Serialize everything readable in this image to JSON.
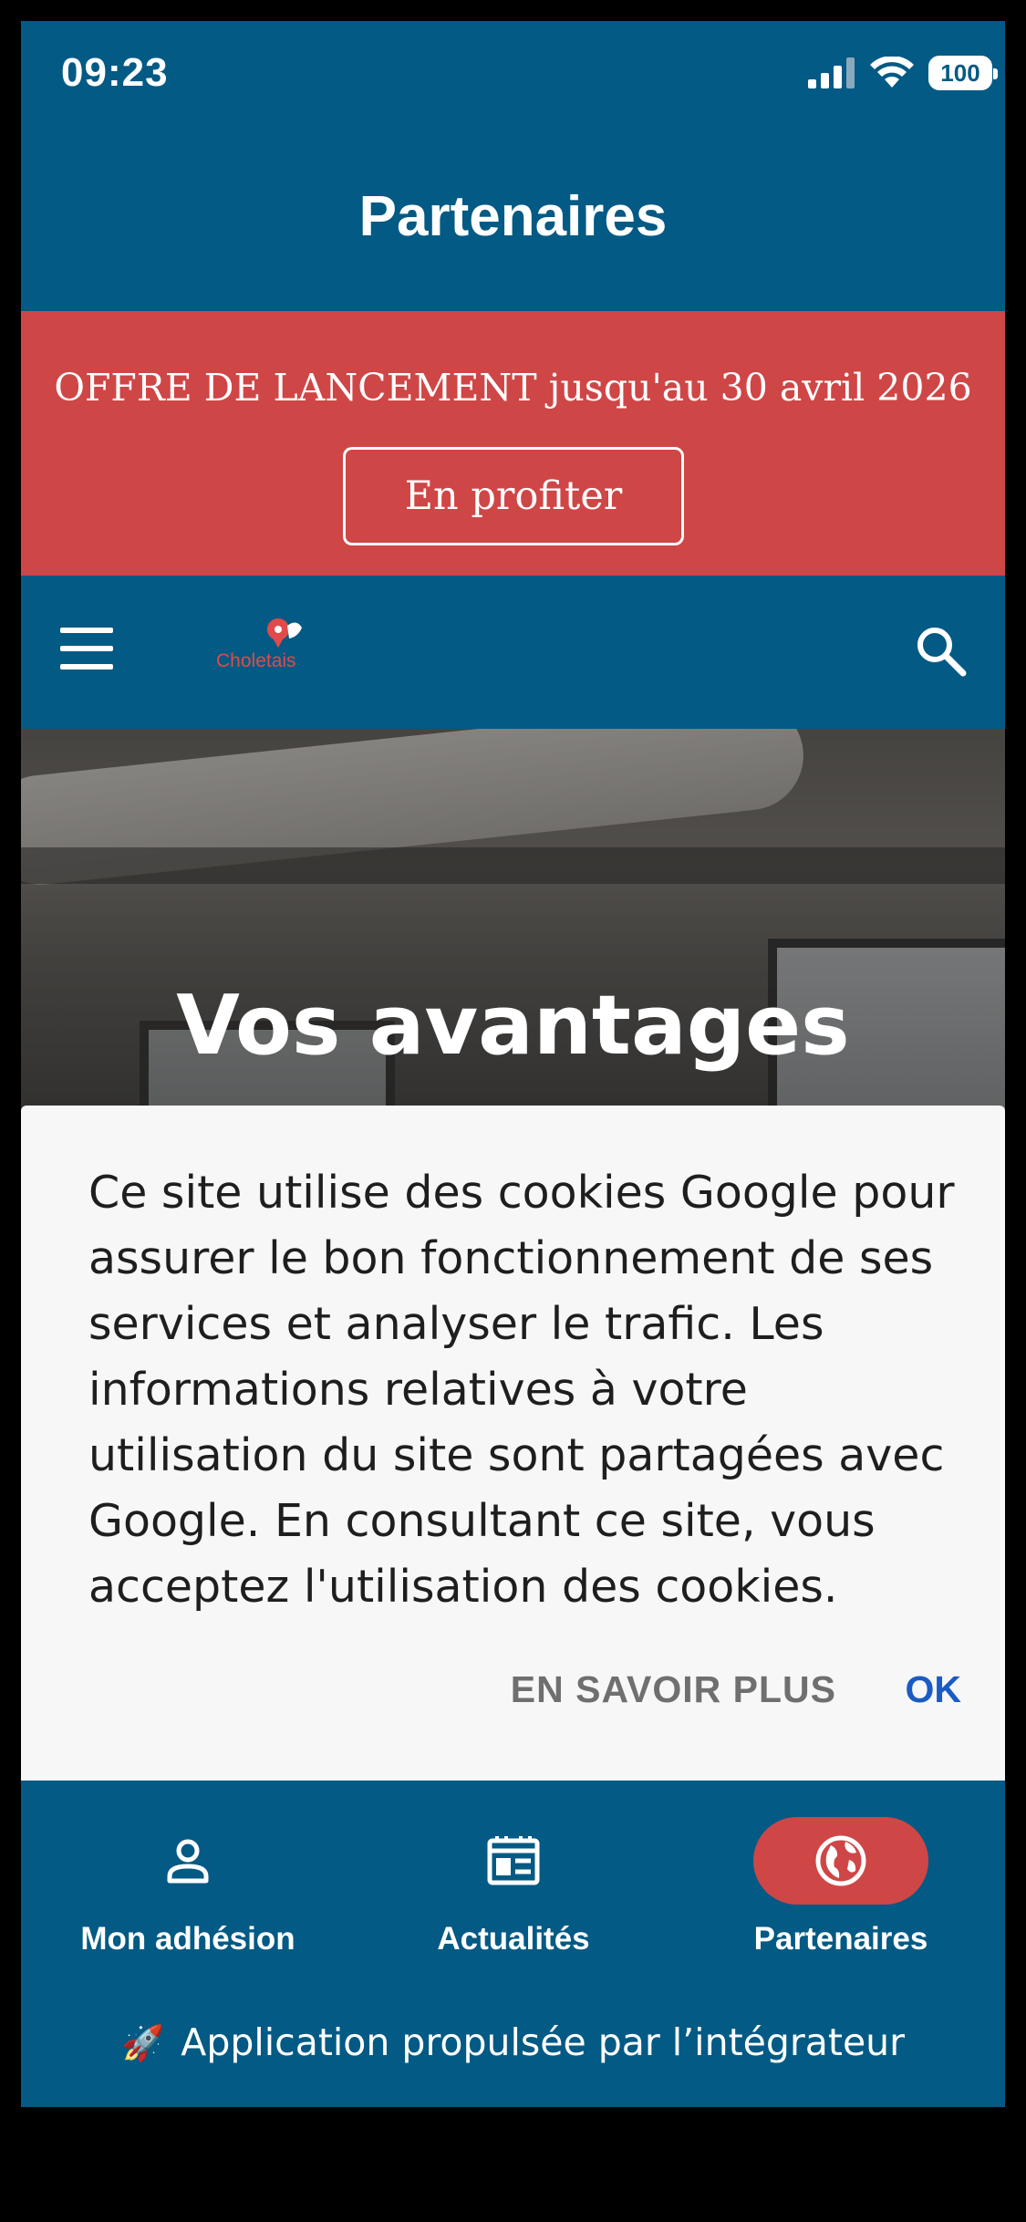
{
  "status_bar": {
    "time": "09:23",
    "battery": "100"
  },
  "header": {
    "title": "Partenaires"
  },
  "promo": {
    "text": "OFFRE DE LANCEMENT jusqu'au 30 avril 2026",
    "button_label": "En profiter"
  },
  "site_nav": {
    "logo_text": "Choletais"
  },
  "hero": {
    "title": "Vos avantages"
  },
  "cookie_banner": {
    "text": "Ce site utilise des cookies Google pour assurer le bon fonctionnement de ses services et analyser le trafic. Les informations relatives à votre utilisation du site sont partagées avec Google. En consultant ce site, vous acceptez l'utilisation des cookies.",
    "more_label": "EN SAVOIR PLUS",
    "ok_label": "OK"
  },
  "tabs": [
    {
      "label": "Mon adhésion",
      "icon": "person-icon",
      "active": false
    },
    {
      "label": "Actualités",
      "icon": "newspaper-icon",
      "active": false
    },
    {
      "label": "Partenaires",
      "icon": "globe-icon",
      "active": true
    }
  ],
  "footer": {
    "text": "Application propulsée par l’intégrateur",
    "icon": "rocket-icon"
  },
  "colors": {
    "primary": "#035a84",
    "accent": "#cf4646",
    "link": "#1a5bc4"
  }
}
